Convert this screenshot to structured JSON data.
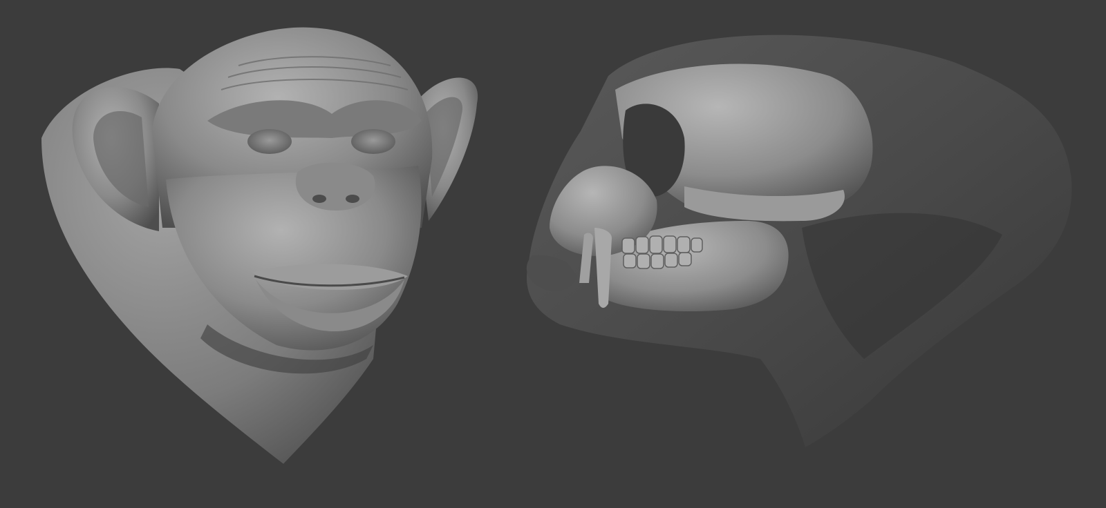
{
  "scene": {
    "background_color": "#3c3c3c",
    "clay_color": "#8e8e8e",
    "clay_highlight": "#b4b4b4",
    "clay_shadow": "#4a4a4a",
    "models": [
      {
        "name": "chimpanzee-head-sculpt",
        "view": "front"
      },
      {
        "name": "primate-skull-sculpt",
        "view": "side"
      }
    ]
  }
}
